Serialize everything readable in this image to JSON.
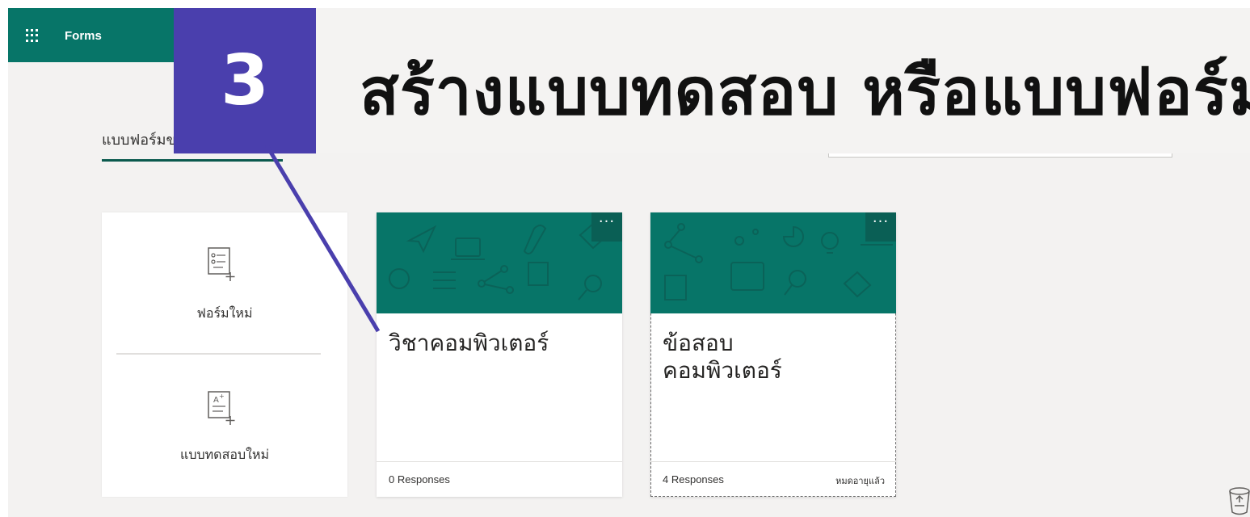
{
  "app": {
    "name": "Forms",
    "launcher_icon": "waffle-icon"
  },
  "callout": {
    "number": "3",
    "title": "สร้างแบบทดสอบ หรือแบบฟอร์ม"
  },
  "tabs": {
    "forms_label": "แบบฟอร์มของฉัน"
  },
  "new_panel": {
    "new_form_label": "ฟอร์มใหม่",
    "new_quiz_label": "แบบทดสอบใหม่"
  },
  "cards": [
    {
      "title": "วิชาคอมพิวเตอร์",
      "responses": "0 Responses",
      "status": "",
      "more": "···"
    },
    {
      "title": "ข้อสอบ\nคอมพิวเตอร์",
      "responses": "4 Responses",
      "status": "หมดอายุแล้ว",
      "more": "···"
    }
  ],
  "colors": {
    "brand": "#077568",
    "callout": "#4a3fad",
    "background": "#f3f2f1"
  }
}
